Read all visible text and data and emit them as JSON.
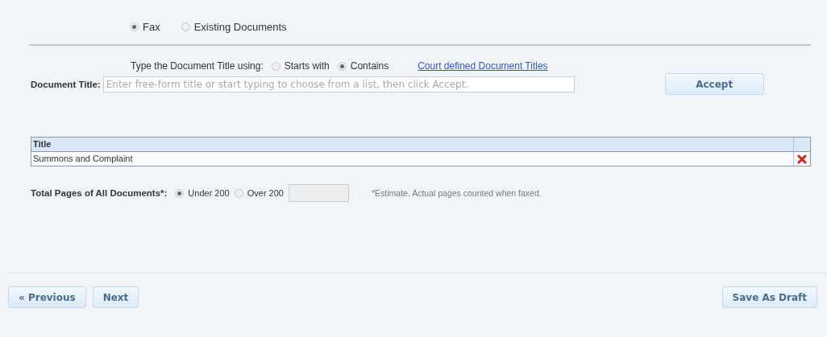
{
  "source_options": [
    {
      "label": "Fax",
      "selected": true
    },
    {
      "label": "Existing Documents",
      "selected": false
    }
  ],
  "match_mode": {
    "prompt": "Type the Document Title using:",
    "options": [
      {
        "label": "Starts with",
        "selected": false
      },
      {
        "label": "Contains",
        "selected": true
      }
    ],
    "link": "Court defined Document Titles"
  },
  "document_title": {
    "label": "Document Title:",
    "placeholder": "Enter free-form title or start typing to choose from a list, then click Accept.",
    "button": "Accept"
  },
  "table": {
    "columns": [
      "Title"
    ],
    "rows": [
      {
        "title": "Summons and Complaint"
      }
    ]
  },
  "total_pages": {
    "label": "Total Pages of All Documents*:",
    "options": [
      {
        "label": "Under 200",
        "selected": true
      },
      {
        "label": "Over 200",
        "selected": false
      }
    ],
    "note": "*Estimate. Actual pages counted when faxed."
  },
  "footer": {
    "previous": "« Previous",
    "next": "Next",
    "save": "Save As Draft"
  }
}
